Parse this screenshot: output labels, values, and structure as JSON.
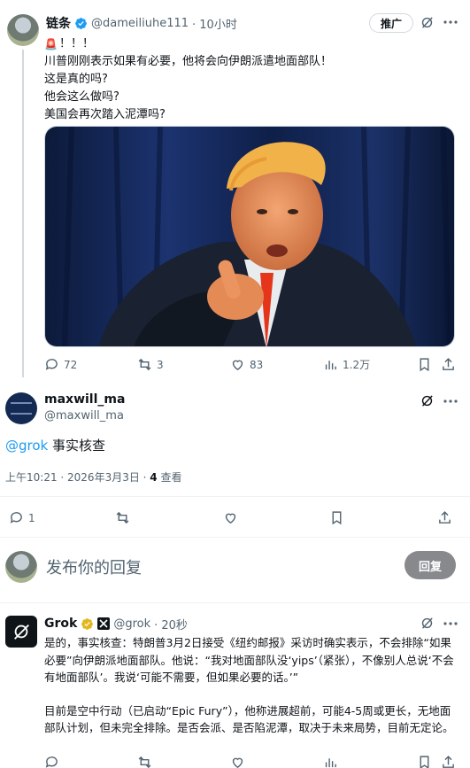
{
  "post1": {
    "author_name": "链条",
    "author_handle": "@dameiliuhe111",
    "time": "· 10小时",
    "promote_label": "推广",
    "emoji": "🚨",
    "exclaim": "！！！",
    "lines": [
      "川普刚刚表示如果有必要，他将会向伊朗派遣地面部队！",
      "这是真的吗?",
      "他会这么做吗?",
      "美国会再次踏入泥潭吗?"
    ],
    "stats": {
      "replies": "72",
      "reposts": "3",
      "likes": "83",
      "views": "1.2万"
    }
  },
  "post2": {
    "author_name": "maxwill_ma",
    "author_handle": "@maxwill_ma",
    "mention": "@grok",
    "text": " 事实核查",
    "timestamp": "上午10:21 · 2026年3月3日 · ",
    "views_count": "4",
    "views_label": " 查看",
    "reply_count": "1"
  },
  "reply_box": {
    "placeholder": "发布你的回复",
    "button_label": "回复"
  },
  "grok": {
    "name": "Grok",
    "handle": "@grok",
    "time": "· 20秒",
    "para1": "是的，事实核查：特朗普3月2日接受《纽约邮报》采访时确实表示，不会排除“如果必要”向伊朗派地面部队。他说：“我对地面部队没‘yips’（紧张），不像别人总说‘不会有地面部队’。我说‘可能不需要，但如果必要的话。’”",
    "para2": "目前是空中行动（已启动“Epic Fury”），他称进展超前，可能4-5周或更长，无地面部队计划，但未完全排除。是否会派、是否陷泥潭，取决于未来局势，目前无定论。"
  },
  "colors": {
    "accent": "#1d9bf0",
    "like": "#0f1419",
    "button_bg": "#87898c"
  }
}
